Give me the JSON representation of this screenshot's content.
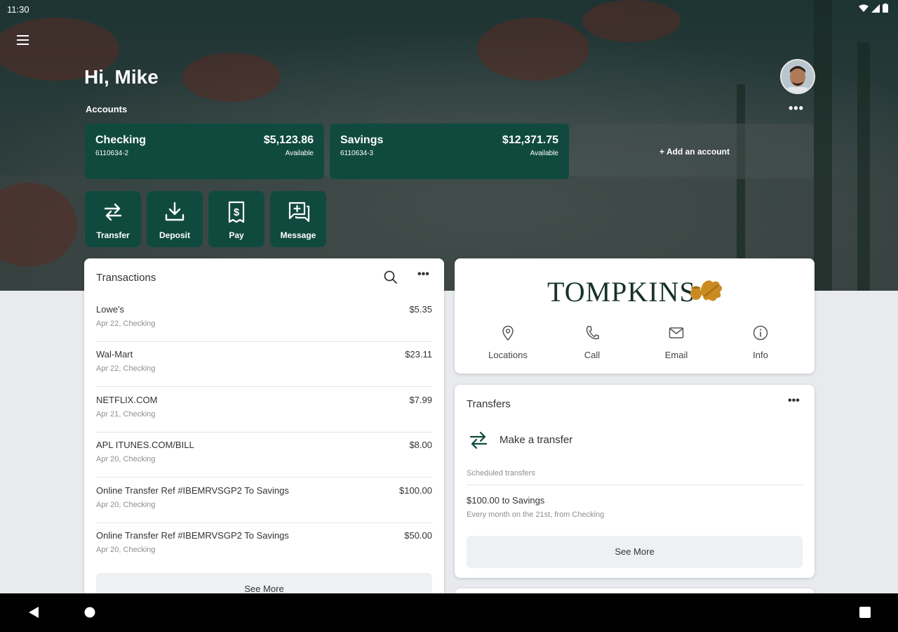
{
  "status_bar": {
    "time": "11:30"
  },
  "header": {
    "greeting": "Hi, Mike",
    "accounts_label": "Accounts",
    "more_label": "•••"
  },
  "accounts": [
    {
      "name": "Checking",
      "number": "6110634-2",
      "balance": "$5,123.86",
      "balance_label": "Available"
    },
    {
      "name": "Savings",
      "number": "6110634-3",
      "balance": "$12,371.75",
      "balance_label": "Available"
    }
  ],
  "add_account_label": "+ Add an account",
  "quick_actions": [
    {
      "label": "Transfer",
      "icon": "transfer-icon"
    },
    {
      "label": "Deposit",
      "icon": "deposit-icon"
    },
    {
      "label": "Pay",
      "icon": "pay-icon"
    },
    {
      "label": "Message",
      "icon": "message-icon"
    }
  ],
  "transactions": {
    "title": "Transactions",
    "more_label": "•••",
    "rows": [
      {
        "description": "Lowe's",
        "meta": "Apr 22, Checking",
        "amount": "$5.35"
      },
      {
        "description": "Wal-Mart",
        "meta": "Apr 22, Checking",
        "amount": "$23.11"
      },
      {
        "description": "NETFLIX.COM",
        "meta": "Apr 21, Checking",
        "amount": "$7.99"
      },
      {
        "description": "APL ITUNES.COM/BILL",
        "meta": "Apr 20, Checking",
        "amount": "$8.00"
      },
      {
        "description": "Online Transfer Ref #IBEMRVSGP2 To Savings",
        "meta": "Apr 20, Checking",
        "amount": "$100.00"
      },
      {
        "description": "Online Transfer Ref #IBEMRVSGP2 To Savings",
        "meta": "Apr 20, Checking",
        "amount": "$50.00"
      }
    ],
    "see_more": "See More"
  },
  "bank": {
    "name": "TOMPKINS",
    "actions": [
      {
        "label": "Locations",
        "icon": "location-pin-icon"
      },
      {
        "label": "Call",
        "icon": "phone-icon"
      },
      {
        "label": "Email",
        "icon": "email-icon"
      },
      {
        "label": "Info",
        "icon": "info-icon"
      }
    ]
  },
  "transfers": {
    "title": "Transfers",
    "more_label": "•••",
    "make_transfer": "Make a transfer",
    "scheduled_label": "Scheduled transfers",
    "scheduled": [
      {
        "title": "$100.00 to Savings",
        "detail": "Every month on the 21st, from Checking"
      }
    ],
    "see_more": "See More"
  },
  "colors": {
    "brand_green": "#104a3e",
    "gold": "#c98a1f"
  }
}
